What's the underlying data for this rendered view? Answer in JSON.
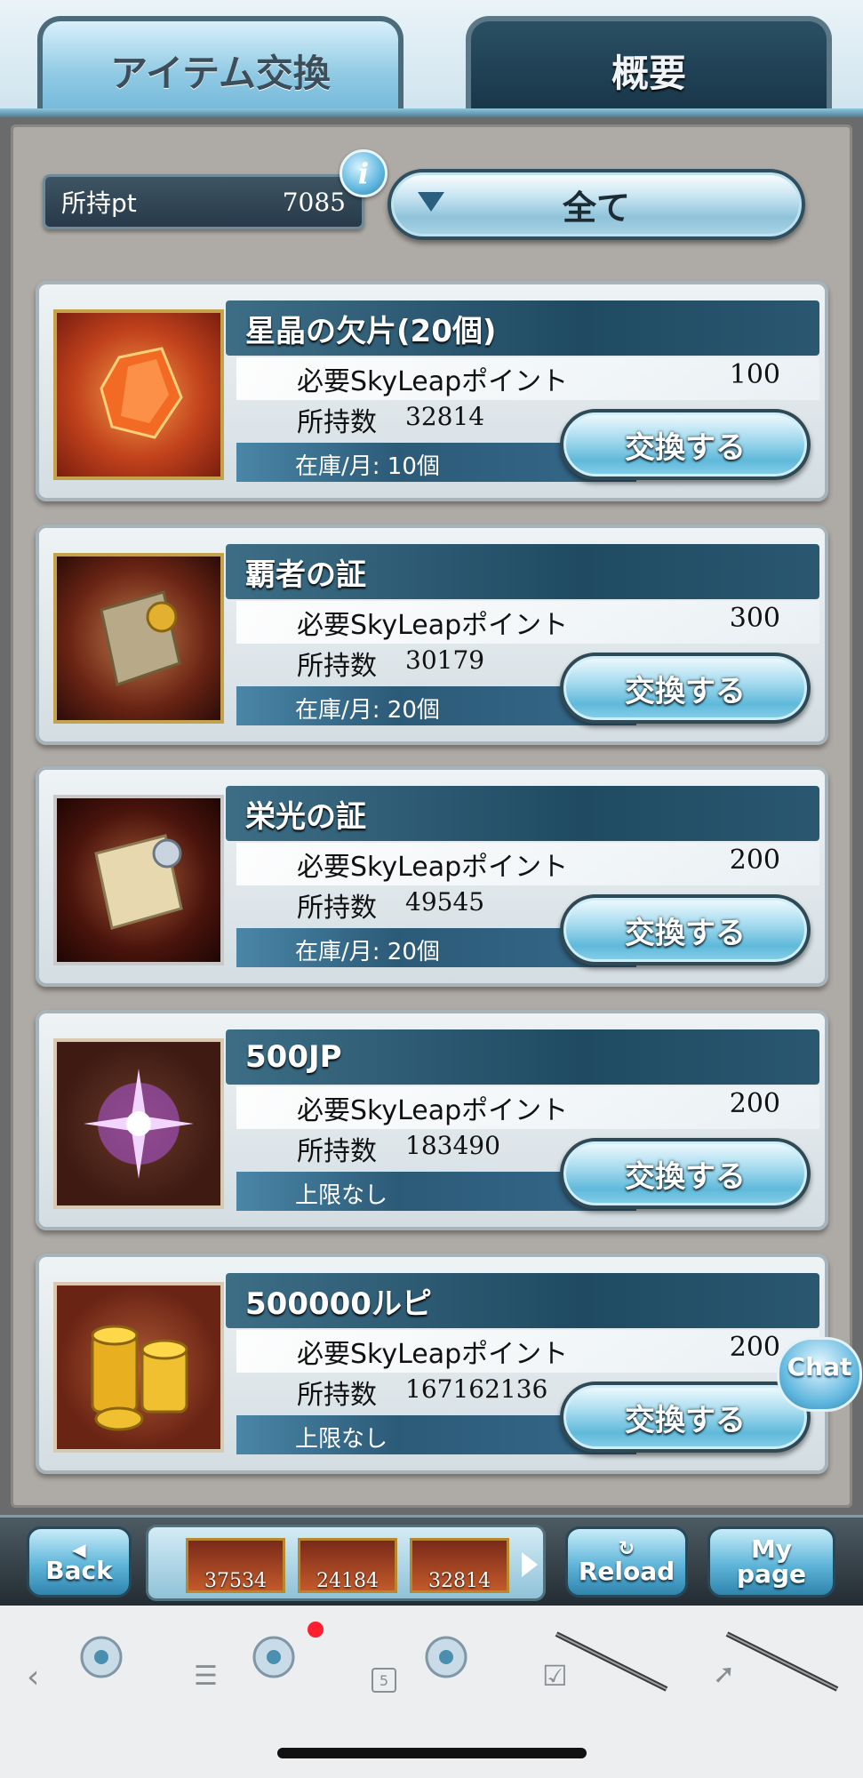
{
  "tabs": {
    "active": "アイテム交換",
    "inactive": "概要"
  },
  "points": {
    "label": "所持pt",
    "value": "7085"
  },
  "filter": {
    "label": "全て"
  },
  "labels": {
    "required": "必要SkyLeapポイント",
    "owned": "所持数",
    "exchange": "交換する"
  },
  "items": [
    {
      "name": "星晶の欠片(20個)",
      "required": "100",
      "owned": "32814",
      "stock": "在庫/月: 10個",
      "icon": "crystal-shard-icon"
    },
    {
      "name": "覇者の証",
      "required": "300",
      "owned": "30179",
      "stock": "在庫/月: 20個",
      "icon": "champion-scroll-icon"
    },
    {
      "name": "栄光の証",
      "required": "200",
      "owned": "49545",
      "stock": "在庫/月: 20個",
      "icon": "glory-scroll-icon"
    },
    {
      "name": "500JP",
      "required": "200",
      "owned": "183490",
      "stock": "上限なし",
      "icon": "purple-star-icon"
    },
    {
      "name": "500000ルピ",
      "required": "200",
      "owned": "167162136",
      "stock": "上限なし",
      "icon": "gold-coins-icon"
    }
  ],
  "chat": {
    "label": "Chat"
  },
  "gamebar": {
    "back": "Back",
    "reload": "Reload",
    "mypage_1": "My",
    "mypage_2": "page",
    "tray": [
      "37534",
      "24184",
      "32814"
    ]
  },
  "toolbar": {
    "tab_count": "5",
    "icons": [
      "back-arrow-icon",
      "menu-icon",
      "tabs-icon",
      "checkbox-icon",
      "rocket-icon"
    ]
  },
  "colors": {
    "accent": "#5fb9da",
    "title_bar": "#1f4a62",
    "panel": "#aeaaa5"
  }
}
